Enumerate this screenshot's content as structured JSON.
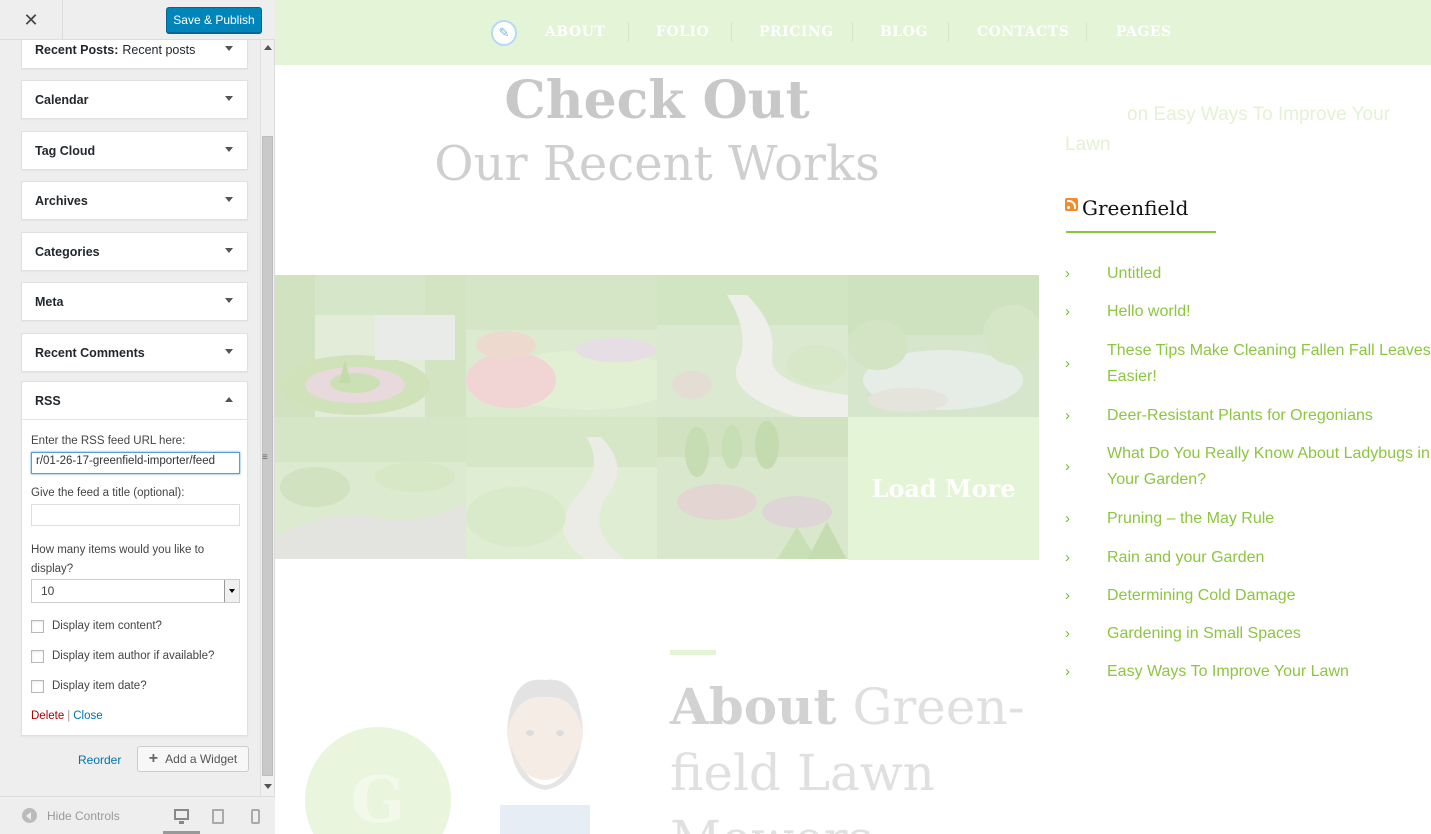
{
  "customizer": {
    "close_icon": "close-icon",
    "publish_label": "Save & Publish",
    "widgets": [
      {
        "title": "Recent Posts:",
        "subtitle": "Recent posts"
      },
      {
        "title": "Calendar"
      },
      {
        "title": "Tag Cloud"
      },
      {
        "title": "Archives"
      },
      {
        "title": "Categories"
      },
      {
        "title": "Meta"
      },
      {
        "title": "Recent Comments"
      }
    ],
    "rss": {
      "title": "RSS",
      "url_label": "Enter the RSS feed URL here:",
      "url_value": "r/01-26-17-greenfield-importer/feed",
      "feed_title_label": "Give the feed a title (optional):",
      "feed_title_value": "",
      "count_label": "How many items would you like to display?",
      "count_value": "10",
      "opt_content": "Display item content?",
      "opt_author": "Display item author if available?",
      "opt_date": "Display item date?",
      "delete_label": "Delete",
      "separator": "|",
      "close_label": "Close"
    },
    "reorder_label": "Reorder",
    "add_widget_label": "Add a Widget",
    "hide_controls_label": "Hide Controls",
    "accent": "#0085ba"
  },
  "preview": {
    "nav": [
      "ABOUT",
      "FOLIO",
      "PRICING",
      "BLOG",
      "CONTACTS",
      "PAGES"
    ],
    "check_out": "Check Out",
    "recent_works": "Our Recent Works",
    "load_more": "Load More",
    "about_bold": "About",
    "about_rest": "Green-field Lawn Mowers",
    "circle_letter": "G",
    "recent_comment": "on Easy Ways To Improve Your Lawn",
    "sidebar": {
      "rss_title": "Greenfield",
      "items": [
        "Untitled",
        "Hello world!",
        "These Tips Make Cleaning Fallen Fall Leaves Easier!",
        "Deer-Resistant Plants for Oregonians",
        "What Do You Really Know About Ladybugs in Your Garden?",
        "Pruning – the May Rule",
        "Rain and your Garden",
        "Determining Cold Damage",
        "Gardening in Small Spaces",
        "Easy Ways To Improve Your Lawn"
      ],
      "link_color": "#8cc63f"
    }
  }
}
